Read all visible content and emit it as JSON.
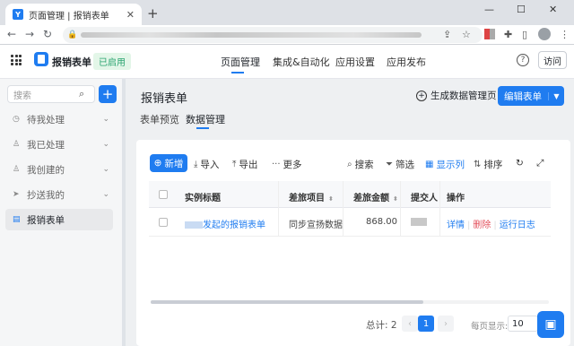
{
  "browser": {
    "tab_title": "页面管理 | 报销表单",
    "new_tab": "+",
    "minimize": "—",
    "maximize": "☐",
    "close": "✕"
  },
  "header": {
    "app_name": "报销表单",
    "status_badge": "已启用",
    "nav": [
      {
        "label": "页面管理"
      },
      {
        "label": "集成&自动化"
      },
      {
        "label": "应用设置"
      },
      {
        "label": "应用发布"
      }
    ],
    "help": "?",
    "visit_label": "访问"
  },
  "sidebar": {
    "search_placeholder": "搜索",
    "add": "+",
    "items": [
      {
        "label": "待我处理",
        "icon": "clock-icon"
      },
      {
        "label": "我已处理",
        "icon": "user-check-icon"
      },
      {
        "label": "我创建的",
        "icon": "user-icon"
      },
      {
        "label": "抄送我的",
        "icon": "send-icon"
      },
      {
        "label": "报销表单",
        "icon": "document-icon"
      }
    ]
  },
  "main": {
    "title": "报销表单",
    "generate_label": "生成数据管理页",
    "edit_label": "编辑表单",
    "tabs": [
      {
        "label": "表单预览"
      },
      {
        "label": "数据管理"
      }
    ]
  },
  "toolbar": {
    "new_label": "新增",
    "import_label": "导入",
    "export_label": "导出",
    "more_label": "更多",
    "search_label": "搜索",
    "filter_label": "筛选",
    "columns_label": "显示列",
    "sort_label": "排序"
  },
  "table": {
    "columns": [
      "实例标题",
      "差旅项目",
      "差旅金额",
      "提交人",
      "操作"
    ],
    "rows": [
      {
        "title": "发起的报销表单",
        "project": "同步宣扬数据",
        "amount": "868.00",
        "actions": [
          "详情",
          "删除",
          "运行日志"
        ]
      }
    ]
  },
  "pagination": {
    "total": "总计: 2",
    "current_page": "1",
    "page_size_label": "每页显示:",
    "page_size": "10"
  },
  "colors": {
    "accent": "#1f7cf0",
    "enabled_bg": "#e3f6e8",
    "enabled_text": "#2ba471",
    "danger": "#e34d59"
  }
}
